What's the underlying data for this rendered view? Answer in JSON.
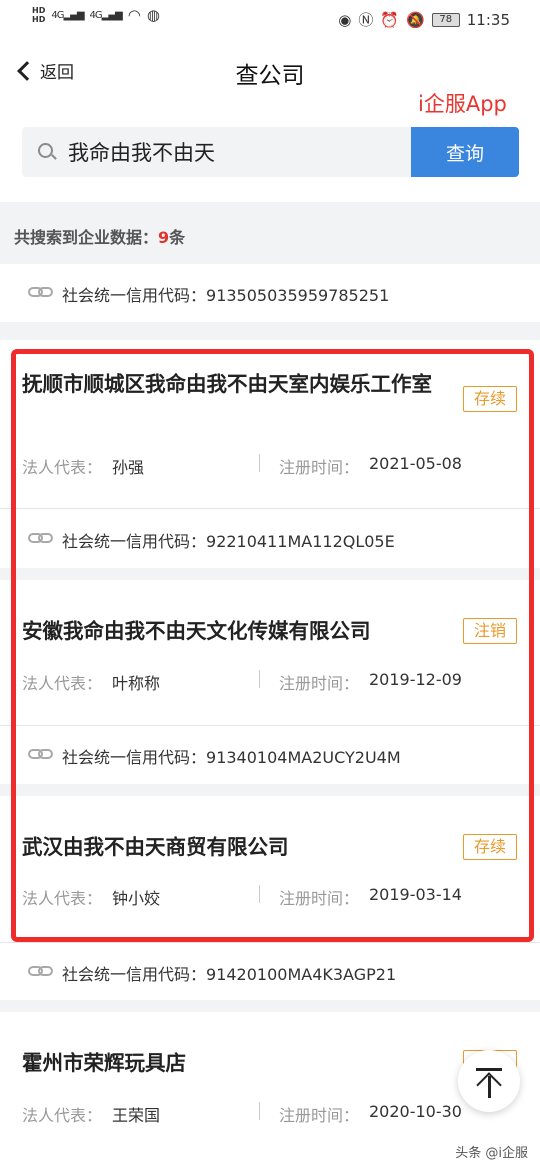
{
  "status_bar": {
    "network_1": "4G",
    "network_2": "4G",
    "battery": "78",
    "time": "11:35"
  },
  "nav": {
    "back_label": "返回",
    "title": "查公司"
  },
  "watermark": "i企服App",
  "search": {
    "value": "我命由我不由天",
    "button_label": "查询"
  },
  "result": {
    "prefix": "共搜索到企业数据：",
    "count": "9",
    "suffix": "条"
  },
  "labels": {
    "credit_code": "社会统一信用代码：",
    "legal_rep": "法人代表：",
    "reg_time": "注册时间："
  },
  "top_credit_code": "913505035959785251",
  "companies": [
    {
      "name": "抚顺市顺城区我命由我不由天室内娱乐工作室",
      "status": "存续",
      "legal_rep": "孙强",
      "reg_date": "2021-05-08",
      "credit_code": "92210411MA112QL05E"
    },
    {
      "name": "安徽我命由我不由天文化传媒有限公司",
      "status": "注销",
      "legal_rep": "叶称称",
      "reg_date": "2019-12-09",
      "credit_code": "91340104MA2UCY2U4M"
    },
    {
      "name": "武汉由我不由天商贸有限公司",
      "status": "存续",
      "legal_rep": "钟小姣",
      "reg_date": "2019-03-14",
      "credit_code": "91420100MA4K3AGP21"
    },
    {
      "name": "霍州市荣辉玩具店",
      "status": "",
      "legal_rep": "王荣国",
      "reg_date": "2020-10-30"
    }
  ],
  "footer_credit": "头条 @i企服"
}
